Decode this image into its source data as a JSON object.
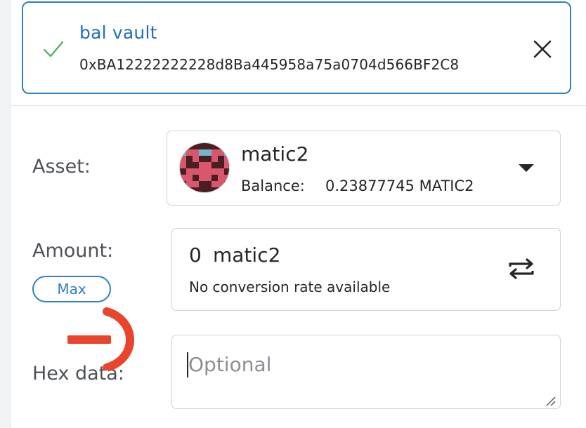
{
  "recipient": {
    "name": "bal vault",
    "address": "0xBA12222222228d8Ba445958a75a0704d566BF2C8"
  },
  "asset": {
    "label": "Asset:",
    "token_name": "matic2",
    "balance_label": "Balance:",
    "balance_value": "0.23877745 MATIC2"
  },
  "amount": {
    "label": "Amount:",
    "max_label": "Max",
    "value": "0",
    "unit": "matic2",
    "conversion": "No conversion rate available"
  },
  "hex": {
    "label": "Hex data:",
    "placeholder": "Optional",
    "value": ""
  },
  "colors": {
    "accent": "#2f7fc9",
    "check": "#4caf50",
    "annotation": "#e8452c"
  },
  "icons": {
    "check": "check-icon",
    "close": "close-icon",
    "caret": "caret-down-icon",
    "swap": "swap-icon",
    "resize": "resize-handle-icon",
    "annotation": "red-arrow-annotation"
  }
}
